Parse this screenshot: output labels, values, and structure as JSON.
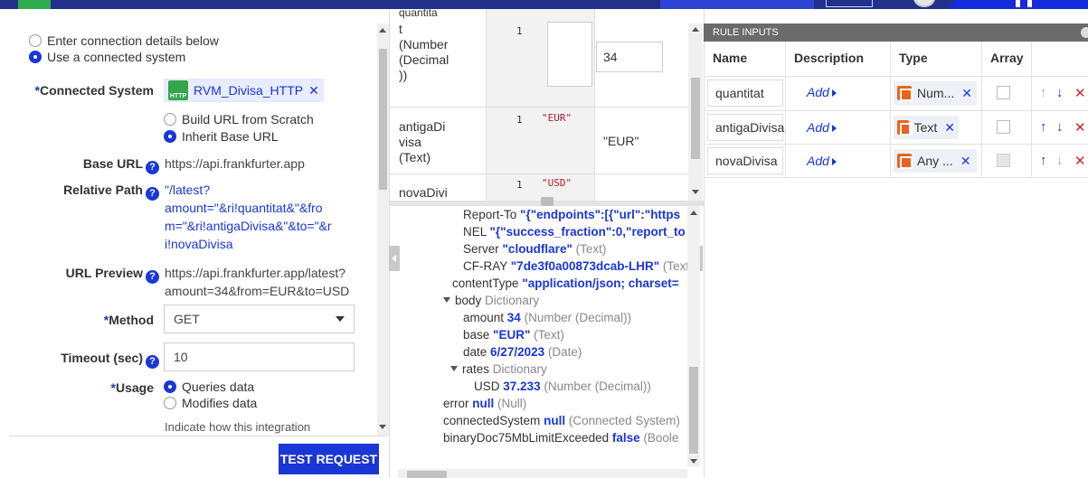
{
  "left_panel": {
    "connection_options": [
      "Enter connection details below",
      "Use a connected system"
    ],
    "connected_system": {
      "label": "Connected System",
      "value": "RVM_Divisa_HTTP",
      "icon": "http-icon"
    },
    "url_options": [
      "Build URL from Scratch",
      "Inherit Base URL"
    ],
    "base_url": {
      "label": "Base URL",
      "value": "https://api.frankfurter.app"
    },
    "relative_path": {
      "label": "Relative Path",
      "lines": [
        "\"/latest?",
        "amount=\"&ri!quantitat&\"&fro",
        "m=\"&ri!antigaDivisa&\"&to=\"&r",
        "i!novaDivisa"
      ]
    },
    "url_preview": {
      "label": "URL Preview",
      "lines": [
        "https://api.frankfurter.app/latest?",
        "amount=34&from=EUR&to=USD"
      ]
    },
    "method": {
      "label": "Method",
      "value": "GET"
    },
    "timeout": {
      "label": "Timeout (sec)",
      "value": "10"
    },
    "usage": {
      "label": "Usage",
      "options": [
        "Queries data",
        "Modifies data"
      ],
      "hint": "Indicate how this integration"
    },
    "test_button": "TEST REQUEST"
  },
  "inputs_table": {
    "rows": [
      {
        "name_lines": [
          "quantita",
          "t",
          "(Number",
          "(Decimal",
          "))"
        ],
        "index": "1",
        "value": "34"
      },
      {
        "name_lines": [
          "antigaDi",
          "visa",
          "(Text)"
        ],
        "index": "1",
        "literal": "\"EUR\"",
        "value": "\"EUR\""
      },
      {
        "name_lines": [
          "novaDivi"
        ],
        "index": "1",
        "literal": "\"USD\""
      }
    ],
    "top_cut_text": "quantita"
  },
  "output_tree": {
    "rows": [
      {
        "key": "Report-To",
        "value": "\"{\"endpoints\":[{\"url\":\"https"
      },
      {
        "key": "NEL",
        "value": "\"{\"success_fraction\":0,\"report_to"
      },
      {
        "key": "Server",
        "value": "\"cloudflare\"",
        "type": "(Text)"
      },
      {
        "key": "CF-RAY",
        "value": "\"7de3f0a00873dcab-LHR\"",
        "type": "(Text"
      },
      {
        "key": "contentType",
        "value": "\"application/json; charset="
      },
      {
        "key": "body",
        "type": "Dictionary"
      },
      {
        "key": "amount",
        "value": "34",
        "type": "(Number (Decimal))"
      },
      {
        "key": "base",
        "value": "\"EUR\"",
        "type": "(Text)"
      },
      {
        "key": "date",
        "value": "6/27/2023",
        "type": "(Date)"
      },
      {
        "key": "rates",
        "type": "Dictionary"
      },
      {
        "key": "USD",
        "value": "37.233",
        "type": "(Number (Decimal))"
      },
      {
        "key": "error",
        "value": "null",
        "type": "(Null)"
      },
      {
        "key": "connectedSystem",
        "value": "null",
        "type": "(Connected System)"
      },
      {
        "key": "binaryDoc75MbLimitExceeded",
        "value": "false",
        "type": "(Boole"
      }
    ]
  },
  "rule_inputs": {
    "title": "RULE INPUTS",
    "columns": [
      "Name",
      "Description",
      "Type",
      "Array"
    ],
    "rows": [
      {
        "name": "quantitat",
        "description": "Add",
        "type": "Num...",
        "type_icon": "number-type-icon"
      },
      {
        "name": "antigaDivisa",
        "description": "Add",
        "type": "Text",
        "type_icon": "text-type-icon"
      },
      {
        "name": "novaDivisa",
        "description": "Add",
        "type": "Any ...",
        "type_icon": "any-type-icon"
      }
    ]
  },
  "colors": {
    "accent": "#1a36d6",
    "header_bar": "#22308c",
    "type_icon": "#e8641c",
    "delete": "#d1232f"
  }
}
